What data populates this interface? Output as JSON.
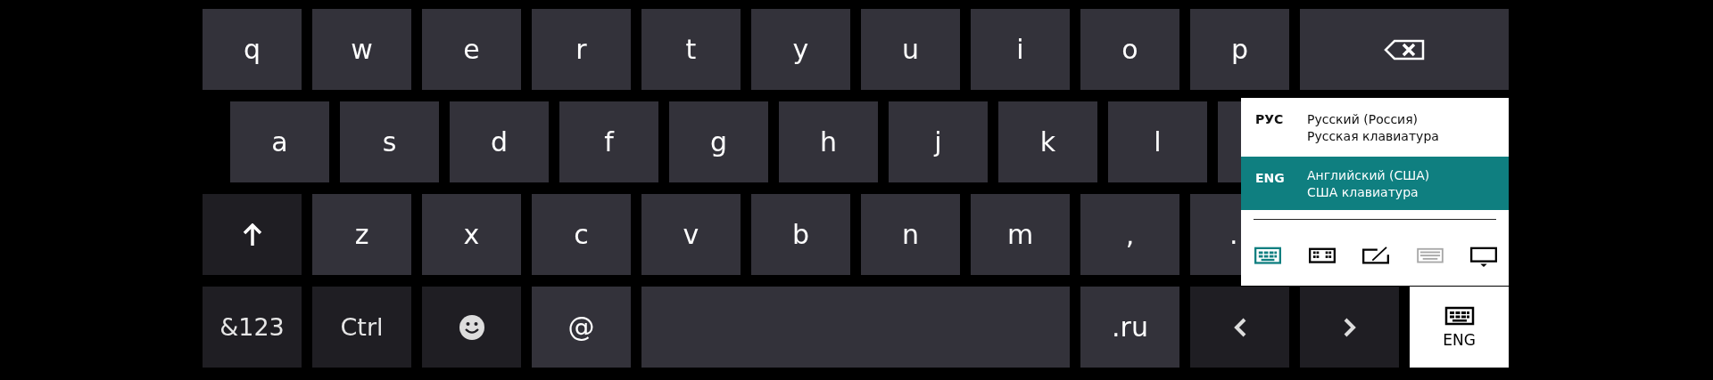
{
  "keyboard": {
    "rows": [
      {
        "keys": [
          {
            "kind": "char",
            "label": "q"
          },
          {
            "kind": "char",
            "label": "w"
          },
          {
            "kind": "char",
            "label": "e"
          },
          {
            "kind": "char",
            "label": "r"
          },
          {
            "kind": "char",
            "label": "t"
          },
          {
            "kind": "char",
            "label": "y"
          },
          {
            "kind": "char",
            "label": "u"
          },
          {
            "kind": "char",
            "label": "i"
          },
          {
            "kind": "char",
            "label": "o"
          },
          {
            "kind": "char",
            "label": "p"
          },
          {
            "kind": "backspace"
          }
        ]
      },
      {
        "keys": [
          {
            "kind": "char",
            "label": "a"
          },
          {
            "kind": "char",
            "label": "s"
          },
          {
            "kind": "char",
            "label": "d"
          },
          {
            "kind": "char",
            "label": "f"
          },
          {
            "kind": "char",
            "label": "g"
          },
          {
            "kind": "char",
            "label": "h"
          },
          {
            "kind": "char",
            "label": "j"
          },
          {
            "kind": "char",
            "label": "k"
          },
          {
            "kind": "char",
            "label": "l"
          },
          {
            "kind": "partial"
          }
        ]
      },
      {
        "keys": [
          {
            "kind": "shift"
          },
          {
            "kind": "char",
            "label": "z"
          },
          {
            "kind": "char",
            "label": "x"
          },
          {
            "kind": "char",
            "label": "c"
          },
          {
            "kind": "char",
            "label": "v"
          },
          {
            "kind": "char",
            "label": "b"
          },
          {
            "kind": "char",
            "label": "n"
          },
          {
            "kind": "char",
            "label": "m"
          },
          {
            "kind": "char",
            "label": ","
          },
          {
            "kind": "partial",
            "label": "."
          }
        ]
      },
      {
        "keys": [
          {
            "kind": "function",
            "label": "&123"
          },
          {
            "kind": "function",
            "label": "Ctrl"
          },
          {
            "kind": "emoji"
          },
          {
            "kind": "char",
            "label": "@"
          },
          {
            "kind": "space"
          },
          {
            "kind": "char",
            "label": ".ru"
          },
          {
            "kind": "left"
          },
          {
            "kind": "right"
          },
          {
            "kind": "language",
            "label": "ENG"
          }
        ]
      }
    ]
  },
  "language_menu": {
    "languages": [
      {
        "code": "РУС",
        "name": "Русский (Россия)",
        "layout": "Русская клавиатура",
        "selected": false
      },
      {
        "code": "ENG",
        "name": "Английский (США)",
        "layout": "США клавиатура",
        "selected": true
      }
    ],
    "modes": [
      {
        "kind": "standard",
        "selected": true,
        "disabled": false
      },
      {
        "kind": "split",
        "selected": false,
        "disabled": false
      },
      {
        "kind": "handwriting",
        "selected": false,
        "disabled": false
      },
      {
        "kind": "full",
        "selected": false,
        "disabled": true
      },
      {
        "kind": "dock",
        "selected": false,
        "disabled": false
      }
    ]
  }
}
